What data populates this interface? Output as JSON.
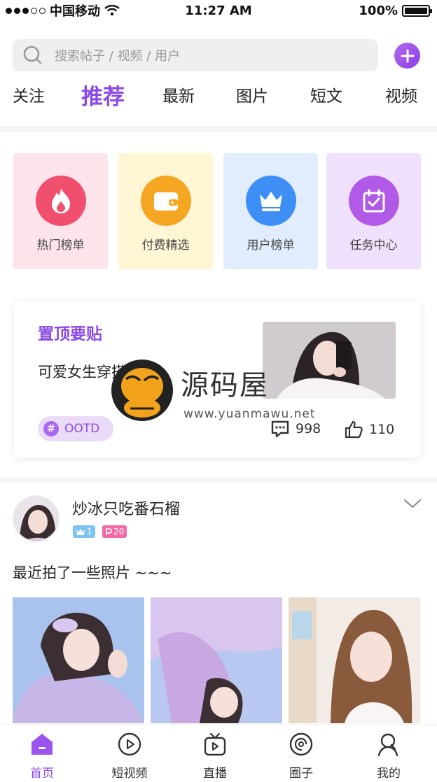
{
  "status_bar": {
    "carrier": "中国移动",
    "time": "11:27 AM",
    "battery": "100%",
    "battery_level": 1.0
  },
  "search": {
    "placeholder": "搜索帖子 / 视频 / 用户"
  },
  "tabs": [
    {
      "label": "关注"
    },
    {
      "label": "推荐",
      "active": true
    },
    {
      "label": "最新"
    },
    {
      "label": "图片"
    },
    {
      "label": "短文"
    },
    {
      "label": "视频"
    }
  ],
  "categories": [
    {
      "label": "热门榜单",
      "icon": "flame-icon",
      "bg": "#fde3ea",
      "circle": "#f0506e"
    },
    {
      "label": "付费精选",
      "icon": "wallet-icon",
      "bg": "#fff6d6",
      "circle": "#f5a623"
    },
    {
      "label": "用户榜单",
      "icon": "crown-icon",
      "bg": "#e1ecfd",
      "circle": "#3d8ef5"
    },
    {
      "label": "任务中心",
      "icon": "calendar-check-icon",
      "bg": "#efe1fb",
      "circle": "#b25ae8"
    }
  ],
  "pinned": {
    "title": "置顶要贴",
    "description": "可爱女生穿搭视频",
    "tag": "OOTD",
    "comments": "998",
    "likes": "110"
  },
  "watermark": {
    "title": "源码屋",
    "url": "www.yuanmawu.net"
  },
  "post": {
    "username": "炒冰只吃番石榴",
    "badge_level": "1",
    "badge_points": "20",
    "text": "最近拍了一些照片 ~~~"
  },
  "nav": [
    {
      "label": "首页",
      "icon": "home-icon",
      "active": true
    },
    {
      "label": "短视频",
      "icon": "play-circle-icon"
    },
    {
      "label": "直播",
      "icon": "tv-icon"
    },
    {
      "label": "圈子",
      "icon": "circle-spiral-icon"
    },
    {
      "label": "我的",
      "icon": "user-icon"
    }
  ],
  "colors": {
    "accent": "#8b4ae6",
    "accent_light": "#eadcf9"
  }
}
